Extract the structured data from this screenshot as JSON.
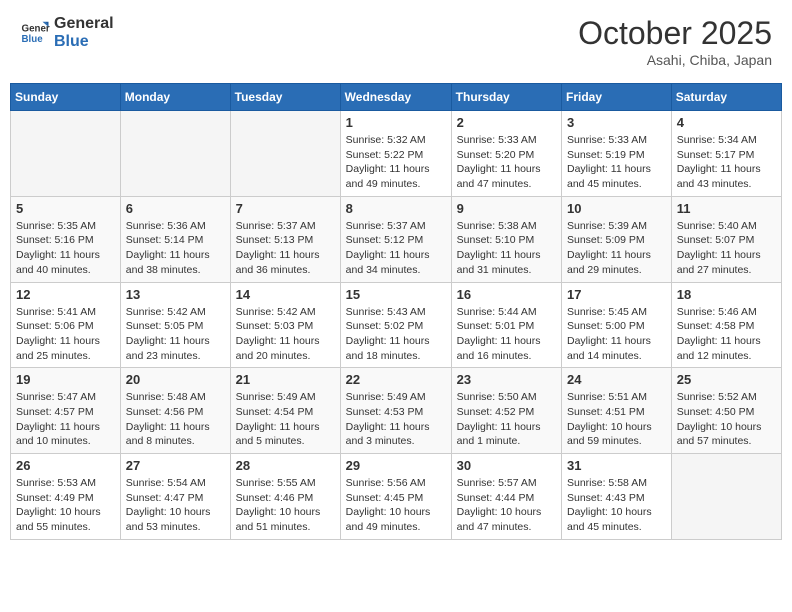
{
  "header": {
    "logo": {
      "line1": "General",
      "line2": "Blue"
    },
    "month": "October 2025",
    "location": "Asahi, Chiba, Japan"
  },
  "days_of_week": [
    "Sunday",
    "Monday",
    "Tuesday",
    "Wednesday",
    "Thursday",
    "Friday",
    "Saturday"
  ],
  "weeks": [
    [
      {
        "day": "",
        "info": ""
      },
      {
        "day": "",
        "info": ""
      },
      {
        "day": "",
        "info": ""
      },
      {
        "day": "1",
        "info": "Sunrise: 5:32 AM\nSunset: 5:22 PM\nDaylight: 11 hours\nand 49 minutes."
      },
      {
        "day": "2",
        "info": "Sunrise: 5:33 AM\nSunset: 5:20 PM\nDaylight: 11 hours\nand 47 minutes."
      },
      {
        "day": "3",
        "info": "Sunrise: 5:33 AM\nSunset: 5:19 PM\nDaylight: 11 hours\nand 45 minutes."
      },
      {
        "day": "4",
        "info": "Sunrise: 5:34 AM\nSunset: 5:17 PM\nDaylight: 11 hours\nand 43 minutes."
      }
    ],
    [
      {
        "day": "5",
        "info": "Sunrise: 5:35 AM\nSunset: 5:16 PM\nDaylight: 11 hours\nand 40 minutes."
      },
      {
        "day": "6",
        "info": "Sunrise: 5:36 AM\nSunset: 5:14 PM\nDaylight: 11 hours\nand 38 minutes."
      },
      {
        "day": "7",
        "info": "Sunrise: 5:37 AM\nSunset: 5:13 PM\nDaylight: 11 hours\nand 36 minutes."
      },
      {
        "day": "8",
        "info": "Sunrise: 5:37 AM\nSunset: 5:12 PM\nDaylight: 11 hours\nand 34 minutes."
      },
      {
        "day": "9",
        "info": "Sunrise: 5:38 AM\nSunset: 5:10 PM\nDaylight: 11 hours\nand 31 minutes."
      },
      {
        "day": "10",
        "info": "Sunrise: 5:39 AM\nSunset: 5:09 PM\nDaylight: 11 hours\nand 29 minutes."
      },
      {
        "day": "11",
        "info": "Sunrise: 5:40 AM\nSunset: 5:07 PM\nDaylight: 11 hours\nand 27 minutes."
      }
    ],
    [
      {
        "day": "12",
        "info": "Sunrise: 5:41 AM\nSunset: 5:06 PM\nDaylight: 11 hours\nand 25 minutes."
      },
      {
        "day": "13",
        "info": "Sunrise: 5:42 AM\nSunset: 5:05 PM\nDaylight: 11 hours\nand 23 minutes."
      },
      {
        "day": "14",
        "info": "Sunrise: 5:42 AM\nSunset: 5:03 PM\nDaylight: 11 hours\nand 20 minutes."
      },
      {
        "day": "15",
        "info": "Sunrise: 5:43 AM\nSunset: 5:02 PM\nDaylight: 11 hours\nand 18 minutes."
      },
      {
        "day": "16",
        "info": "Sunrise: 5:44 AM\nSunset: 5:01 PM\nDaylight: 11 hours\nand 16 minutes."
      },
      {
        "day": "17",
        "info": "Sunrise: 5:45 AM\nSunset: 5:00 PM\nDaylight: 11 hours\nand 14 minutes."
      },
      {
        "day": "18",
        "info": "Sunrise: 5:46 AM\nSunset: 4:58 PM\nDaylight: 11 hours\nand 12 minutes."
      }
    ],
    [
      {
        "day": "19",
        "info": "Sunrise: 5:47 AM\nSunset: 4:57 PM\nDaylight: 11 hours\nand 10 minutes."
      },
      {
        "day": "20",
        "info": "Sunrise: 5:48 AM\nSunset: 4:56 PM\nDaylight: 11 hours\nand 8 minutes."
      },
      {
        "day": "21",
        "info": "Sunrise: 5:49 AM\nSunset: 4:54 PM\nDaylight: 11 hours\nand 5 minutes."
      },
      {
        "day": "22",
        "info": "Sunrise: 5:49 AM\nSunset: 4:53 PM\nDaylight: 11 hours\nand 3 minutes."
      },
      {
        "day": "23",
        "info": "Sunrise: 5:50 AM\nSunset: 4:52 PM\nDaylight: 11 hours\nand 1 minute."
      },
      {
        "day": "24",
        "info": "Sunrise: 5:51 AM\nSunset: 4:51 PM\nDaylight: 10 hours\nand 59 minutes."
      },
      {
        "day": "25",
        "info": "Sunrise: 5:52 AM\nSunset: 4:50 PM\nDaylight: 10 hours\nand 57 minutes."
      }
    ],
    [
      {
        "day": "26",
        "info": "Sunrise: 5:53 AM\nSunset: 4:49 PM\nDaylight: 10 hours\nand 55 minutes."
      },
      {
        "day": "27",
        "info": "Sunrise: 5:54 AM\nSunset: 4:47 PM\nDaylight: 10 hours\nand 53 minutes."
      },
      {
        "day": "28",
        "info": "Sunrise: 5:55 AM\nSunset: 4:46 PM\nDaylight: 10 hours\nand 51 minutes."
      },
      {
        "day": "29",
        "info": "Sunrise: 5:56 AM\nSunset: 4:45 PM\nDaylight: 10 hours\nand 49 minutes."
      },
      {
        "day": "30",
        "info": "Sunrise: 5:57 AM\nSunset: 4:44 PM\nDaylight: 10 hours\nand 47 minutes."
      },
      {
        "day": "31",
        "info": "Sunrise: 5:58 AM\nSunset: 4:43 PM\nDaylight: 10 hours\nand 45 minutes."
      },
      {
        "day": "",
        "info": ""
      }
    ]
  ]
}
